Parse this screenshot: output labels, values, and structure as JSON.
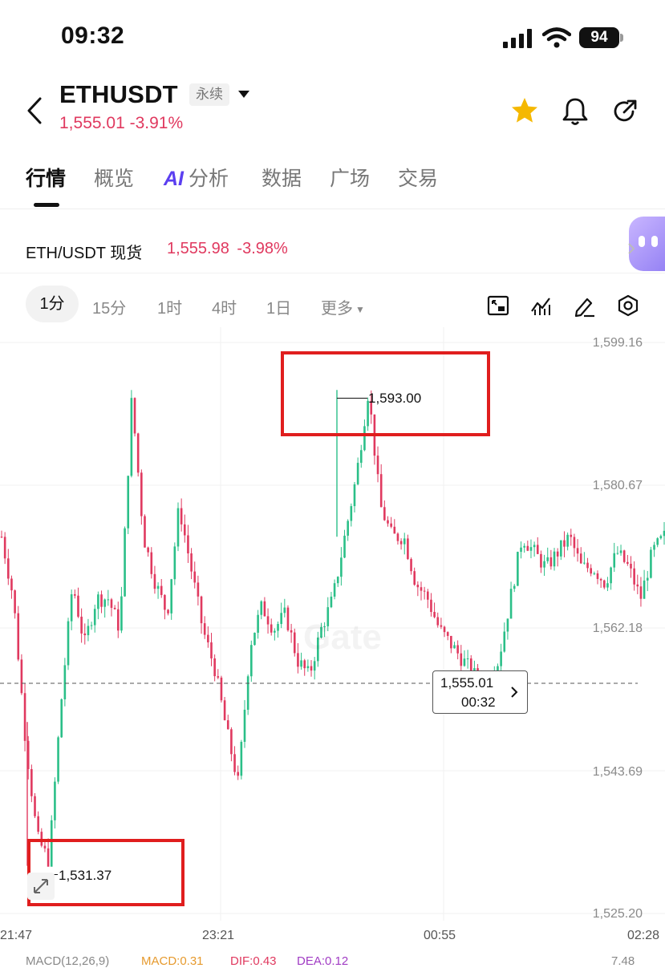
{
  "status_bar": {
    "time": "09:32",
    "battery": "94"
  },
  "header": {
    "symbol": "ETHUSDT",
    "contract_type": "永续",
    "price": "1,555.01",
    "change": "-3.91%"
  },
  "tabs": [
    {
      "label": "行情",
      "active": true
    },
    {
      "label": "概览"
    },
    {
      "label": "分析",
      "prefix": "AI"
    },
    {
      "label": "数据"
    },
    {
      "label": "广场"
    },
    {
      "label": "交易"
    }
  ],
  "spot": {
    "label": "ETH/USDT 现货",
    "price": "1,555.98",
    "change": "-3.98%"
  },
  "intervals": [
    "1分",
    "15分",
    "1时",
    "4时",
    "1日",
    "更多"
  ],
  "selected_interval": "1分",
  "toolbar_icons": [
    "chart-resize-icon",
    "indicator-icon",
    "draw-icon",
    "settings-icon"
  ],
  "chart": {
    "price_axis": [
      "1,599.16",
      "1,580.67",
      "1,562.18",
      "1,543.69",
      "1,525.20"
    ],
    "time_axis": [
      "21:47",
      "23:21",
      "00:55",
      "02:28"
    ],
    "high_label": "1,593.00",
    "low_label": "1,531.37",
    "current_price": "1,555.01",
    "countdown": "00:32",
    "watermark": "Gate",
    "up_color": "#2bbf88",
    "down_color": "#e0395f"
  },
  "macd": {
    "label": "MACD(12,26,9)",
    "macd": "MACD:0.31",
    "dif": "DIF:0.43",
    "dea": "DEA:0.12",
    "right_value": "7.48"
  },
  "chart_data": {
    "type": "candlestick",
    "x": [
      "21:47",
      "23:21",
      "00:55",
      "02:28"
    ],
    "ylim": [
      1525.2,
      1599.16
    ],
    "yticks": [
      1599.16,
      1580.67,
      1562.18,
      1543.69,
      1525.2
    ],
    "high": 1593.0,
    "low": 1531.37,
    "last": 1555.01,
    "path": [
      1574,
      1566,
      1548,
      1535,
      1532,
      1552,
      1568,
      1560,
      1566,
      1566,
      1562,
      1592,
      1574,
      1568,
      1564,
      1578,
      1570,
      1562,
      1557,
      1549,
      1542,
      1560,
      1565,
      1562,
      1564,
      1558,
      1556,
      1562,
      1566,
      1574,
      1582,
      1593,
      1578,
      1574,
      1574,
      1568,
      1566,
      1562,
      1560,
      1558,
      1556,
      1555,
      1558,
      1566,
      1574,
      1572,
      1570,
      1572,
      1574,
      1570,
      1570,
      1568,
      1572,
      1570,
      1566,
      1572,
      1574
    ]
  }
}
